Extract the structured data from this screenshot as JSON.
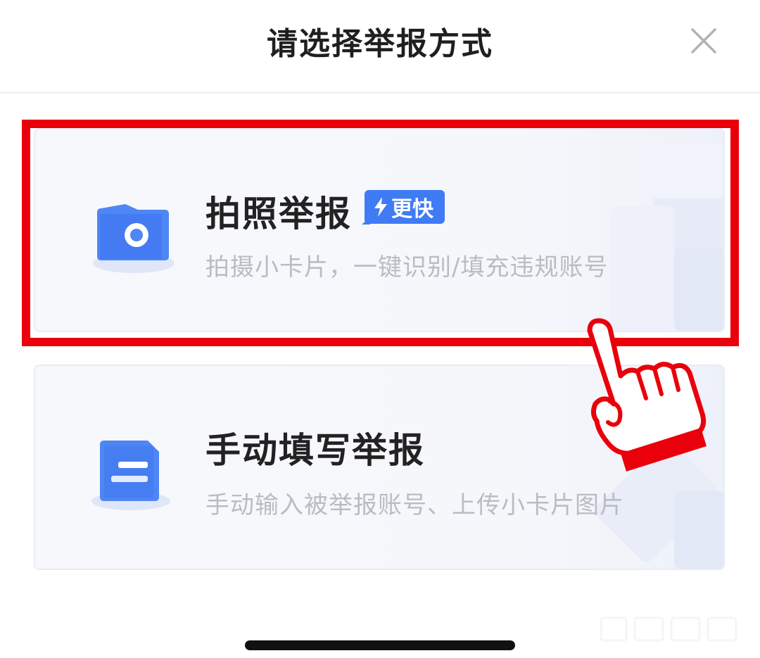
{
  "dialog": {
    "title": "请选择举报方式"
  },
  "options": [
    {
      "title": "拍照举报",
      "badge": "更快",
      "description": "拍摄小卡片，一键识别/填充违规账号",
      "icon": "camera-icon"
    },
    {
      "title": "手动填写举报",
      "description": "手动输入被举报账号、上传小卡片图片",
      "icon": "document-icon"
    }
  ],
  "colors": {
    "accent": "#3f7bf5",
    "highlight": "#e9000b",
    "title_text": "#222222",
    "desc_text": "#b9bcc4"
  }
}
